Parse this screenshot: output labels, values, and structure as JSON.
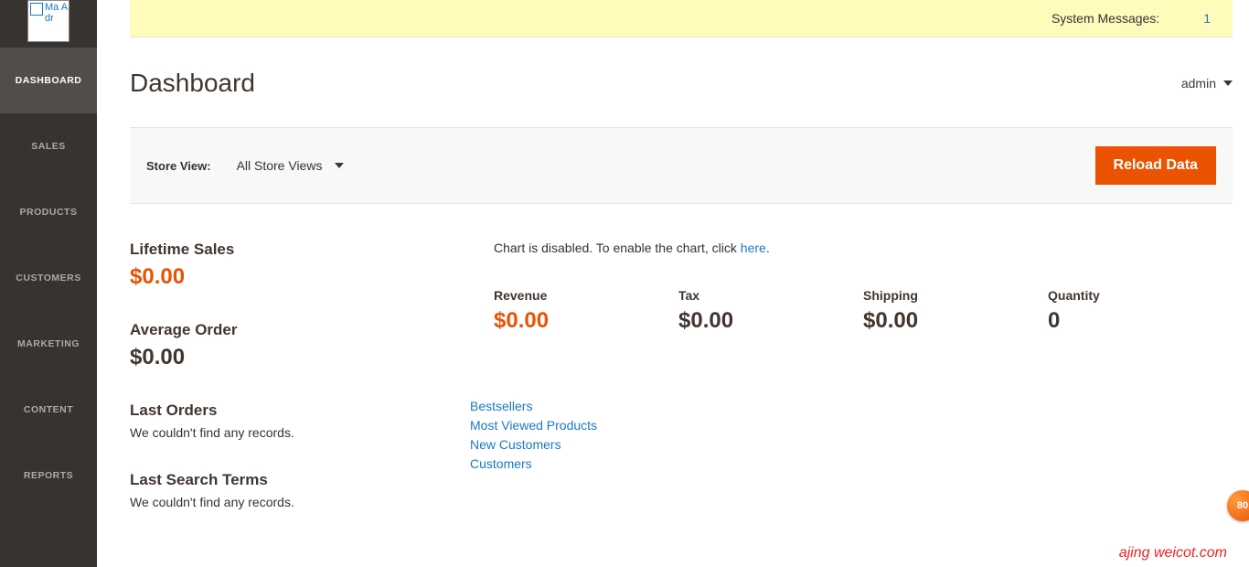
{
  "system_messages": {
    "label": "System Messages:",
    "count": "1"
  },
  "page": {
    "title": "Dashboard"
  },
  "user": {
    "name": "admin"
  },
  "toolbar": {
    "store_view_label": "Store View:",
    "store_view_value": "All Store Views",
    "reload_button": "Reload Data"
  },
  "sidebar": {
    "logo_alt": "Ma Adr",
    "items": [
      {
        "label": "DASHBOARD"
      },
      {
        "label": "SALES"
      },
      {
        "label": "PRODUCTS"
      },
      {
        "label": "CUSTOMERS"
      },
      {
        "label": "MARKETING"
      },
      {
        "label": "CONTENT"
      },
      {
        "label": "REPORTS"
      }
    ]
  },
  "stats": {
    "lifetime_sales": {
      "title": "Lifetime Sales",
      "value": "$0.00"
    },
    "average_order": {
      "title": "Average Order",
      "value": "$0.00"
    },
    "last_orders": {
      "title": "Last Orders",
      "empty": "We couldn't find any records."
    },
    "last_search_terms": {
      "title": "Last Search Terms",
      "empty": "We couldn't find any records."
    }
  },
  "chart_disabled": {
    "prefix": "Chart is disabled. To enable the chart, click ",
    "link": "here",
    "suffix": "."
  },
  "metrics": {
    "revenue": {
      "label": "Revenue",
      "value": "$0.00"
    },
    "tax": {
      "label": "Tax",
      "value": "$0.00"
    },
    "shipping": {
      "label": "Shipping",
      "value": "$0.00"
    },
    "quantity": {
      "label": "Quantity",
      "value": "0"
    }
  },
  "tabs": {
    "bestsellers": "Bestsellers",
    "most_viewed": "Most Viewed Products",
    "new_customers": "New Customers",
    "customers": "Customers"
  },
  "watermark": "ajing weicot.com",
  "badge": "80"
}
